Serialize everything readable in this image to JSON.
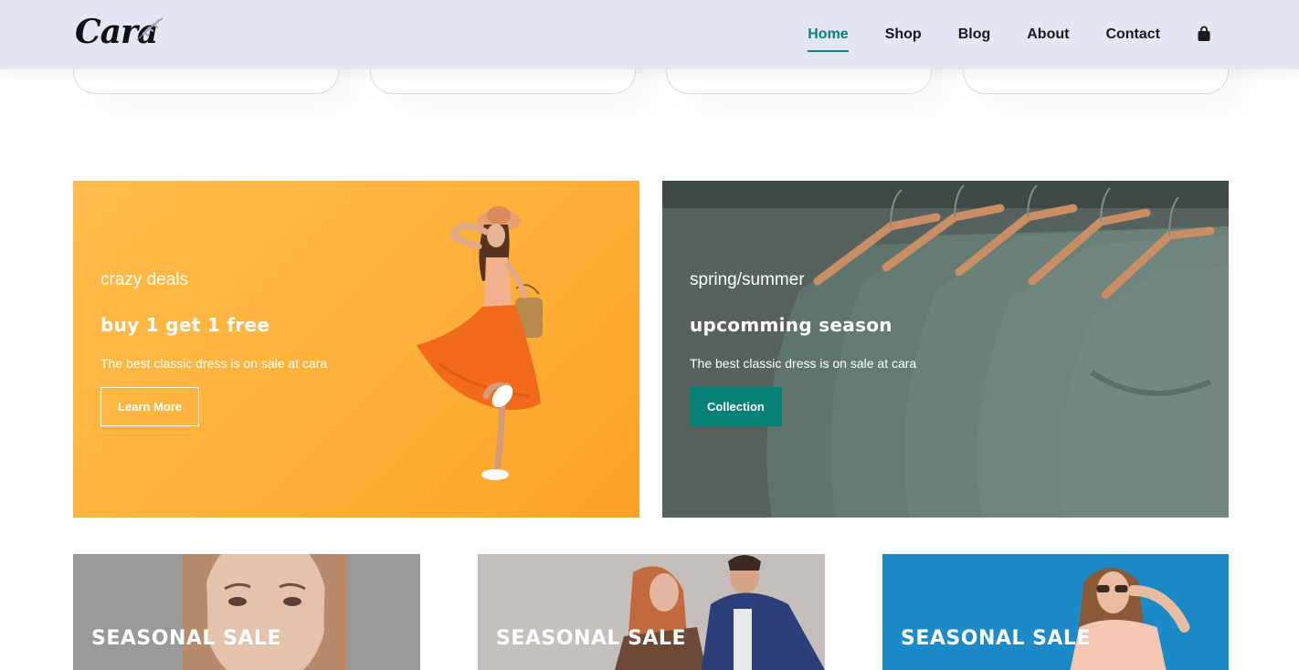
{
  "header": {
    "logo_text": "Cara",
    "nav": [
      {
        "label": "Home",
        "active": true
      },
      {
        "label": "Shop",
        "active": false
      },
      {
        "label": "Blog",
        "active": false
      },
      {
        "label": "About",
        "active": false
      },
      {
        "label": "Contact",
        "active": false
      }
    ],
    "cart_icon": "shopping-bag-icon",
    "accent_color": "#088178",
    "background_color": "#e3e6f3"
  },
  "banners": [
    {
      "subtitle": "crazy deals",
      "heading": "buy 1 get 1 free",
      "text": "The best classic dress is on sale at cara",
      "button_label": "Learn More",
      "background_color": "#ffb13a"
    },
    {
      "subtitle": "spring/summer",
      "heading": "upcomming season",
      "text": "The best classic dress is on sale at cara",
      "button_label": "Collection",
      "background_color": "#4e5c58",
      "button_color": "#088178"
    }
  ],
  "seasonal_banners": [
    {
      "title": "SEASONAL SALE"
    },
    {
      "title": "SEASONAL SALE"
    },
    {
      "title": "SEASONAL SALE"
    }
  ]
}
